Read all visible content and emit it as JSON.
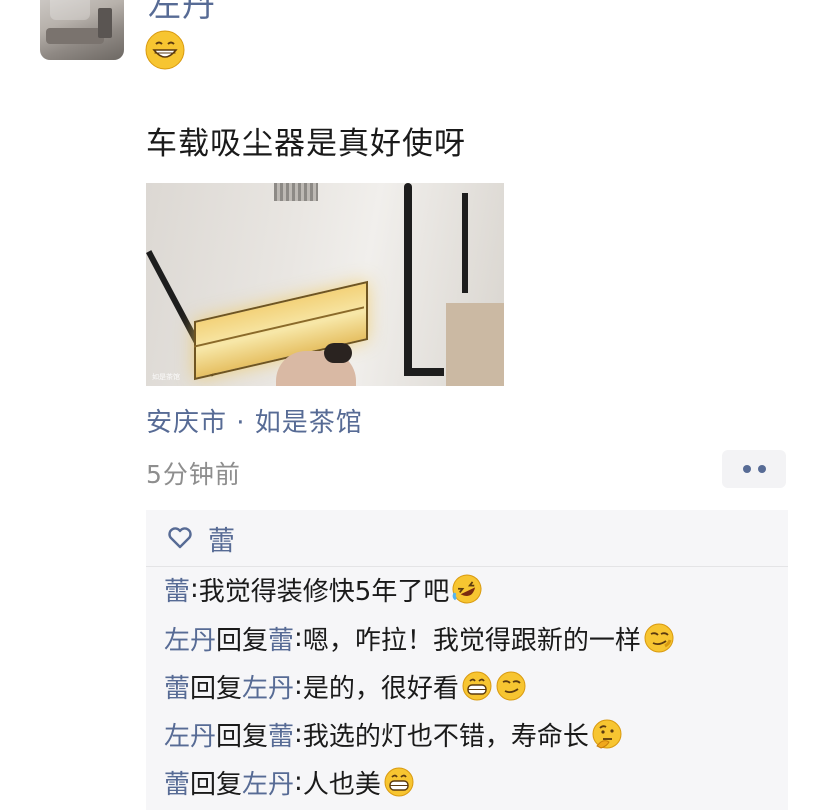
{
  "post": {
    "author": "左丹",
    "text": "车载吸尘器是真好使呀",
    "location": "安庆市 · 如是茶馆",
    "time": "5分钟前",
    "photo_watermark": "如是茶馆"
  },
  "likes": {
    "names": [
      "蕾"
    ]
  },
  "comments": [
    {
      "from": "蕾",
      "reply_word": "",
      "to": "",
      "sep": ": ",
      "text": "我觉得装修快5年了吧",
      "emojis": [
        "rofl-icon"
      ]
    },
    {
      "from": "左丹",
      "reply_word": "回复",
      "to": "蕾",
      "sep": ": ",
      "text": "嗯，咋拉！我觉得跟新的一样",
      "emojis": [
        "smirk-icon"
      ]
    },
    {
      "from": "蕾",
      "reply_word": "回复",
      "to": "左丹",
      "sep": ": ",
      "text": "是的，很好看",
      "emojis": [
        "grin-icon",
        "smirk-icon"
      ]
    },
    {
      "from": "左丹",
      "reply_word": "回复",
      "to": "蕾",
      "sep": ": ",
      "text": "我选的灯也不错，寿命长",
      "emojis": [
        "thinking-icon"
      ]
    },
    {
      "from": "蕾",
      "reply_word": "回复",
      "to": "左丹",
      "sep": ": ",
      "text": "人也美",
      "emojis": [
        "grin-icon"
      ]
    }
  ],
  "colors": {
    "name_link": "#576b95",
    "text": "#1a1a1a",
    "muted": "#8e8e8e",
    "comment_bg": "#f6f6f8",
    "emoji_yellow": "#f7c531"
  }
}
